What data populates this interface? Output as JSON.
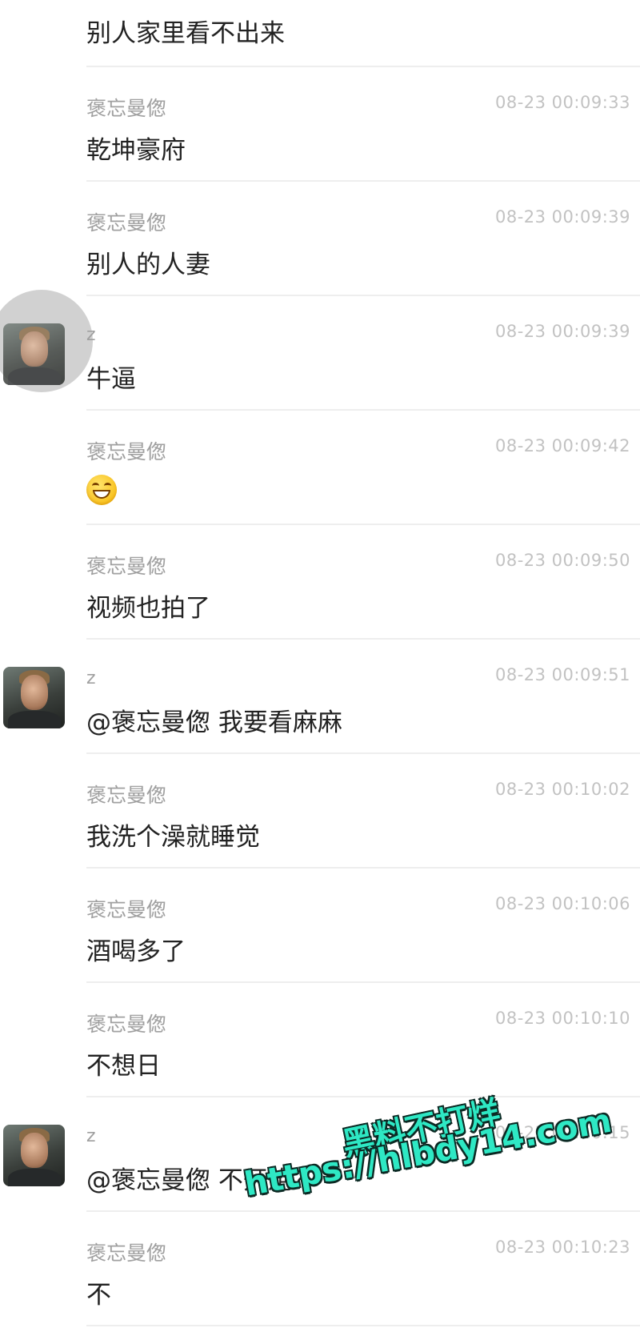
{
  "messages": [
    {
      "sender": "",
      "time": "",
      "text": "别人家里看不出来"
    },
    {
      "sender": "褒忘曼偬",
      "time": "08-23 00:09:33",
      "text": "乾坤豪府"
    },
    {
      "sender": "褒忘曼偬",
      "time": "08-23 00:09:39",
      "text": "别人的人妻"
    },
    {
      "sender": "z",
      "time": "08-23 00:09:39",
      "text": "牛逼"
    },
    {
      "sender": "褒忘曼偬",
      "time": "08-23 00:09:42",
      "text": "",
      "emoji": "grinning-face-emoji"
    },
    {
      "sender": "褒忘曼偬",
      "time": "08-23 00:09:50",
      "text": "视频也拍了"
    },
    {
      "sender": "z",
      "time": "08-23 00:09:51",
      "text": "@褒忘曼偬 我要看麻麻"
    },
    {
      "sender": "褒忘曼偬",
      "time": "08-23 00:10:02",
      "text": "我洗个澡就睡觉"
    },
    {
      "sender": "褒忘曼偬",
      "time": "08-23 00:10:06",
      "text": "酒喝多了"
    },
    {
      "sender": "褒忘曼偬",
      "time": "08-23 00:10:10",
      "text": "不想日"
    },
    {
      "sender": "z",
      "time": "08-23 00:10:15",
      "text": "@褒忘曼偬 不开炮?"
    },
    {
      "sender": "褒忘曼偬",
      "time": "08-23 00:10:23",
      "text": "不"
    }
  ],
  "watermark": {
    "title": "黑料不打烊",
    "url": "https://hlbdy14.com",
    "color": "#2ee8c4"
  }
}
